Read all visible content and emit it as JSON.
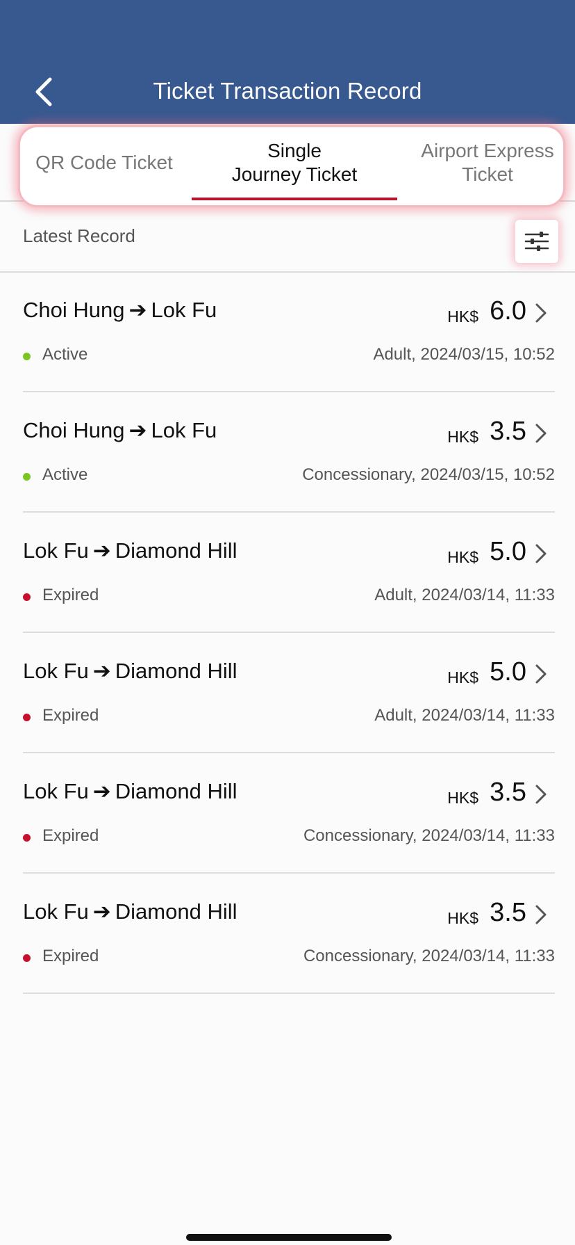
{
  "header": {
    "title": "Ticket Transaction Record",
    "background": "#375990"
  },
  "tabs": [
    {
      "label": "QR Code Ticket",
      "active": false
    },
    {
      "label": "Single\nJourney Ticket",
      "active": true
    },
    {
      "label": "Airport Express\nTicket",
      "active": false
    }
  ],
  "section": {
    "label": "Latest Record"
  },
  "status_colors": {
    "Active": "#7cc521",
    "Expired": "#c8102e"
  },
  "records": [
    {
      "from": "Choi Hung",
      "to": "Lok Fu",
      "currency": "HK$",
      "amount": "6.0",
      "status": "Active",
      "meta": "Adult, 2024/03/15, 10:52"
    },
    {
      "from": "Choi Hung",
      "to": "Lok Fu",
      "currency": "HK$",
      "amount": "3.5",
      "status": "Active",
      "meta": "Concessionary, 2024/03/15, 10:52"
    },
    {
      "from": "Lok Fu",
      "to": "Diamond Hill",
      "currency": "HK$",
      "amount": "5.0",
      "status": "Expired",
      "meta": "Adult, 2024/03/14, 11:33"
    },
    {
      "from": "Lok Fu",
      "to": "Diamond Hill",
      "currency": "HK$",
      "amount": "5.0",
      "status": "Expired",
      "meta": "Adult, 2024/03/14, 11:33"
    },
    {
      "from": "Lok Fu",
      "to": "Diamond Hill",
      "currency": "HK$",
      "amount": "3.5",
      "status": "Expired",
      "meta": "Concessionary, 2024/03/14, 11:33"
    },
    {
      "from": "Lok Fu",
      "to": "Diamond Hill",
      "currency": "HK$",
      "amount": "3.5",
      "status": "Expired",
      "meta": "Concessionary, 2024/03/14, 11:33"
    }
  ],
  "icons": {
    "back": "chevron-left-icon",
    "filter": "sliders-icon",
    "row_arrow": "chevron-right-icon",
    "route_arrow": "➔"
  }
}
